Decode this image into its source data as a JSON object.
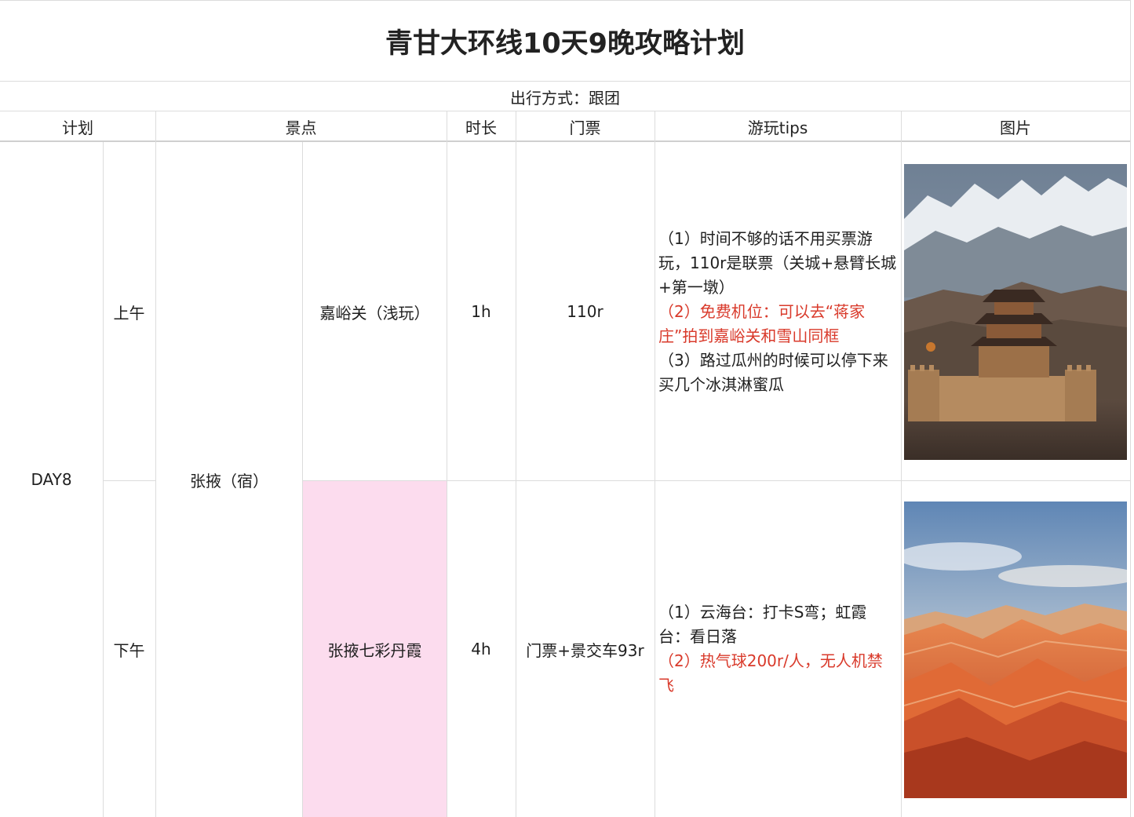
{
  "title": "青甘大环线10天9晚攻略计划",
  "subtitle": "出行方式：跟团",
  "headers": {
    "plan": "计划",
    "spot": "景点",
    "duration": "时长",
    "ticket": "门票",
    "tips": "游玩tips",
    "image": "图片"
  },
  "day": "DAY8",
  "stay": "张掖（宿）",
  "rows": [
    {
      "period": "上午",
      "spot": "嘉峪关（浅玩）",
      "duration": "1h",
      "ticket": "110r",
      "tips": [
        {
          "text": "（1）时间不够的话不用买票游玩，110r是联票（关城+悬臂长城+第一墩）",
          "color": "#1f1f1f"
        },
        {
          "text": "（2）免费机位：可以去“蒋家庄”拍到嘉峪关和雪山同框",
          "color": "#d93a2b"
        },
        {
          "text": "（3）路过瓜州的时候可以停下来买几个冰淇淋蜜瓜",
          "color": "#1f1f1f"
        }
      ],
      "image_icon": "jiayuguan-fortress-photo"
    },
    {
      "period": "下午",
      "spot": "张掖七彩丹霞",
      "duration": "4h",
      "ticket": "门票+景交车93r",
      "spot_highlight": "#fcdcee",
      "tips": [
        {
          "text": "（1）云海台：打卡S弯；虹霞台：看日落",
          "color": "#1f1f1f"
        },
        {
          "text": "（2）热气球200r/人，无人机禁飞",
          "color": "#d93a2b"
        }
      ],
      "image_icon": "danxia-landform-photo"
    }
  ]
}
